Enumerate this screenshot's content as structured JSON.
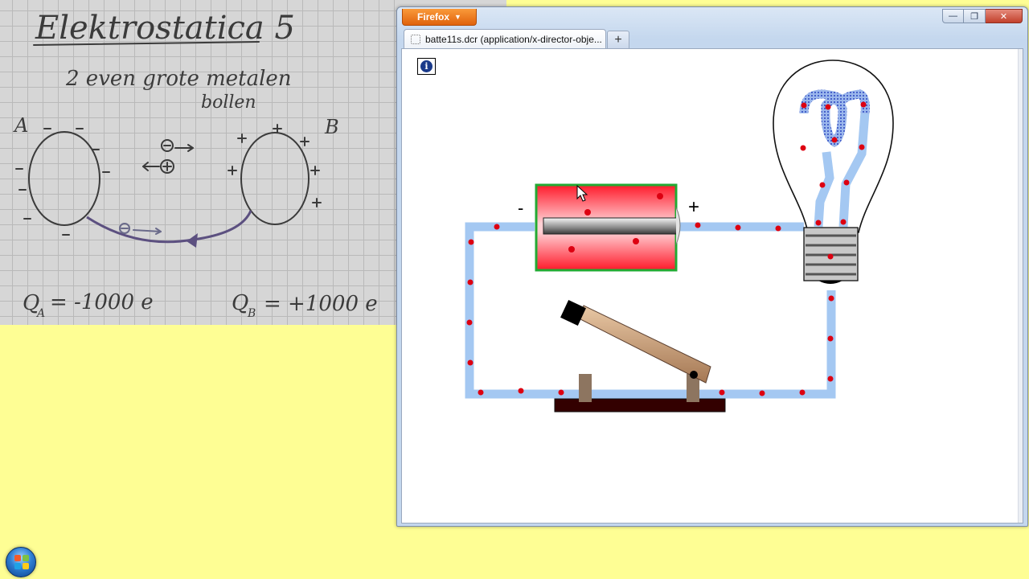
{
  "notebook": {
    "title": "Elektrostatica 5",
    "subtitle_line1": "2 even grote metalen",
    "subtitle_line2": "bollen",
    "label_a": "A",
    "label_b": "B",
    "charge_a_q": "Q",
    "charge_a_sub": "A",
    "charge_a_value": "= -1000 e",
    "charge_b_q": "Q",
    "charge_b_sub": "B",
    "charge_b_value": "= +1000 e"
  },
  "browser": {
    "app_menu_label": "Firefox",
    "tab_title": "batte11s.dcr (application/x-director-obje...",
    "new_tab_label": "+",
    "minimize_icon": "minimize-icon",
    "maximize_icon": "maximize-icon",
    "close_icon": "close-icon"
  },
  "simulation": {
    "info_label": "i",
    "battery_minus": "-",
    "battery_plus": "+",
    "colors": {
      "wire": "#a4c8f2",
      "electron": "#dd0011",
      "battery_red": "#ff2a3a",
      "battery_border": "#22aa33",
      "board": "#330000"
    }
  },
  "taskbar": {
    "start_button_icon": "windows-start-icon"
  }
}
